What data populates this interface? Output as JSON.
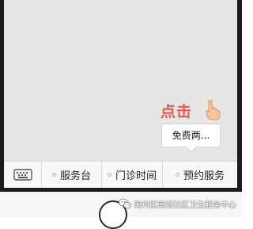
{
  "overlay": {
    "click_hint": "点击",
    "hand_icon": "pointing-hand-icon"
  },
  "submenu": {
    "items": [
      "免费两..."
    ]
  },
  "bottom_menu": {
    "keyboard_icon": "keyboard-icon",
    "items": [
      {
        "label": "服务台"
      },
      {
        "label": "门诊时间"
      },
      {
        "label": "预约服务"
      }
    ]
  },
  "watermark": {
    "text": "海州区南城社区卫生服务中心",
    "icon": "wechat-icon"
  },
  "colors": {
    "hint": "#e05a4f",
    "screen": "#e6e6e6",
    "bezel": "#1c1c1c"
  }
}
